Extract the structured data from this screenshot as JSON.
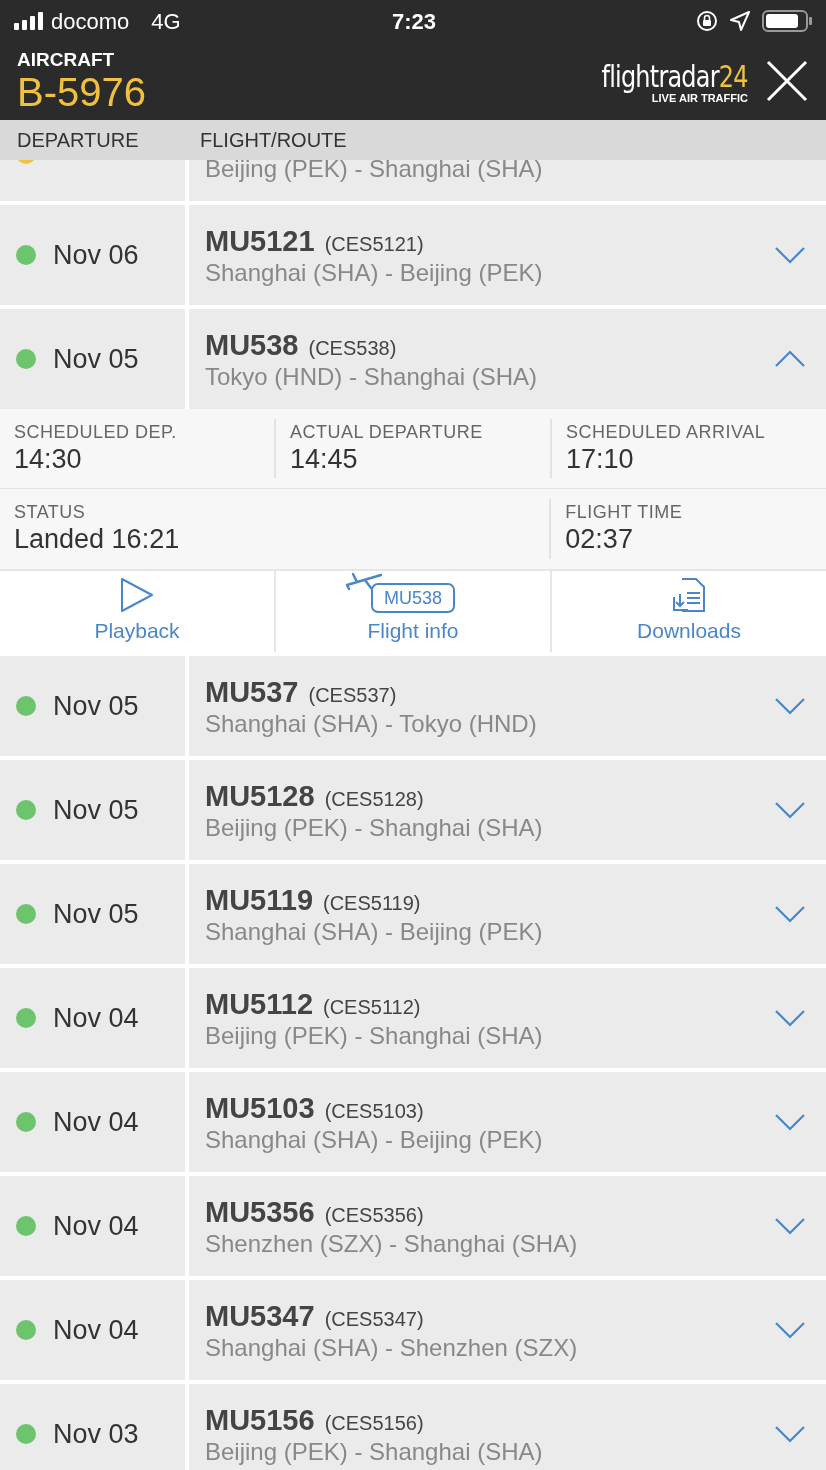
{
  "status_bar": {
    "carrier": "docomo",
    "network": "4G",
    "time": "7:23"
  },
  "header": {
    "label": "AIRCRAFT",
    "registration": "B-5976",
    "logo": {
      "name": "flightradar",
      "number": "24",
      "tagline": "LIVE AIR TRAFFIC"
    }
  },
  "columns": [
    "DEPARTURE",
    "FLIGHT/ROUTE"
  ],
  "partial_row": {
    "route": "Beijing (PEK) - Shanghai (SHA)",
    "color": "#f0c040"
  },
  "flights": [
    {
      "date": "Nov 06",
      "flight": "MU5121",
      "callsign": "(CES5121)",
      "route": "Shanghai (SHA) - Beijing (PEK)",
      "color": "#6cc46c",
      "expanded": false
    },
    {
      "date": "Nov 05",
      "flight": "MU538",
      "callsign": "(CES538)",
      "route": "Tokyo (HND) - Shanghai (SHA)",
      "color": "#6cc46c",
      "expanded": true,
      "details": {
        "times": [
          {
            "label": "SCHEDULED DEP.",
            "value": "14:30"
          },
          {
            "label": "ACTUAL DEPARTURE",
            "value": "14:45"
          },
          {
            "label": "SCHEDULED ARRIVAL",
            "value": "17:10"
          }
        ],
        "status": {
          "label": "STATUS",
          "value": "Landed 16:21"
        },
        "flight_time": {
          "label": "FLIGHT TIME",
          "value": "02:37"
        },
        "actions": [
          {
            "kind": "playback",
            "label": "Playback"
          },
          {
            "kind": "flight_info",
            "badge": "MU538",
            "label": "Flight info"
          },
          {
            "kind": "downloads",
            "label": "Downloads"
          }
        ]
      }
    },
    {
      "date": "Nov 05",
      "flight": "MU537",
      "callsign": "(CES537)",
      "route": "Shanghai (SHA) - Tokyo (HND)",
      "color": "#6cc46c",
      "expanded": false
    },
    {
      "date": "Nov 05",
      "flight": "MU5128",
      "callsign": "(CES5128)",
      "route": "Beijing (PEK) - Shanghai (SHA)",
      "color": "#6cc46c",
      "expanded": false
    },
    {
      "date": "Nov 05",
      "flight": "MU5119",
      "callsign": "(CES5119)",
      "route": "Shanghai (SHA) - Beijing (PEK)",
      "color": "#6cc46c",
      "expanded": false
    },
    {
      "date": "Nov 04",
      "flight": "MU5112",
      "callsign": "(CES5112)",
      "route": "Beijing (PEK) - Shanghai (SHA)",
      "color": "#6cc46c",
      "expanded": false
    },
    {
      "date": "Nov 04",
      "flight": "MU5103",
      "callsign": "(CES5103)",
      "route": "Shanghai (SHA) - Beijing (PEK)",
      "color": "#6cc46c",
      "expanded": false
    },
    {
      "date": "Nov 04",
      "flight": "MU5356",
      "callsign": "(CES5356)",
      "route": "Shenzhen (SZX) - Shanghai (SHA)",
      "color": "#6cc46c",
      "expanded": false
    },
    {
      "date": "Nov 04",
      "flight": "MU5347",
      "callsign": "(CES5347)",
      "route": "Shanghai (SHA) - Shenzhen (SZX)",
      "color": "#6cc46c",
      "expanded": false
    },
    {
      "date": "Nov 03",
      "flight": "MU5156",
      "callsign": "(CES5156)",
      "route": "Beijing (PEK) - Shanghai (SHA)",
      "color": "#6cc46c",
      "expanded": false
    }
  ]
}
